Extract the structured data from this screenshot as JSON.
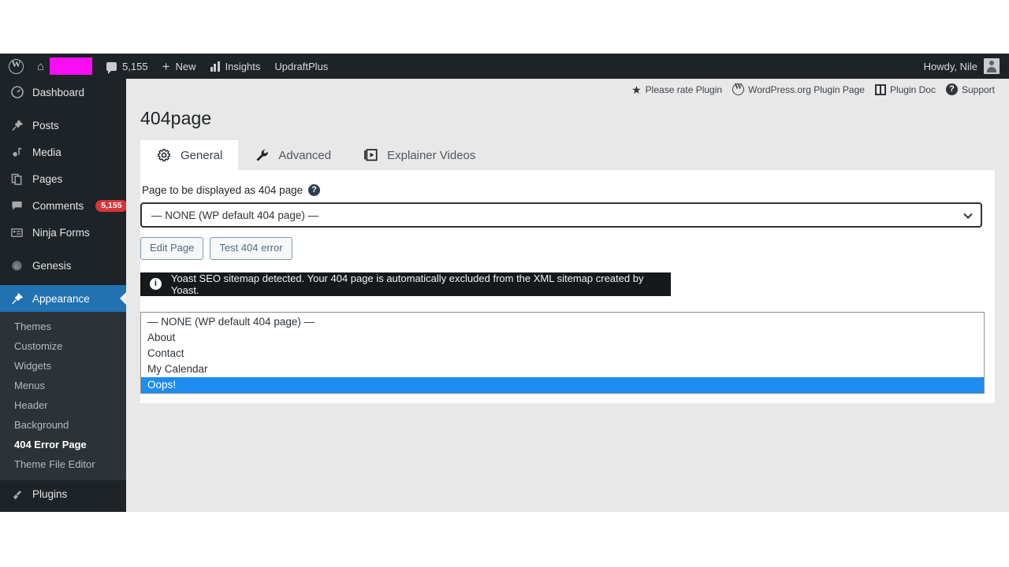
{
  "adminbar": {
    "wp_logo": "wordpress-logo-icon",
    "home_icon": "home-icon",
    "site_name_redacted": "",
    "comment_count": "5,155",
    "new_label": "New",
    "insights_label": "Insights",
    "updraftplus_label": "UpdraftPlus",
    "howdy": "Howdy, Nile"
  },
  "sidebar": {
    "items": [
      {
        "label": "Dashboard",
        "icon": "dashboard-icon",
        "badge": ""
      },
      {
        "label": "Posts",
        "icon": "pin-icon",
        "badge": ""
      },
      {
        "label": "Media",
        "icon": "media-icon",
        "badge": ""
      },
      {
        "label": "Pages",
        "icon": "pages-icon",
        "badge": ""
      },
      {
        "label": "Comments",
        "icon": "comment-icon",
        "badge": "5,155"
      },
      {
        "label": "Ninja Forms",
        "icon": "form-icon",
        "badge": ""
      },
      {
        "label": "Genesis",
        "icon": "genesis-icon",
        "badge": ""
      },
      {
        "label": "Appearance",
        "icon": "brush-icon",
        "badge": ""
      },
      {
        "label": "Plugins",
        "icon": "plug-icon",
        "badge": ""
      }
    ],
    "submenu": [
      {
        "label": "Themes"
      },
      {
        "label": "Customize"
      },
      {
        "label": "Widgets"
      },
      {
        "label": "Menus"
      },
      {
        "label": "Header"
      },
      {
        "label": "Background"
      },
      {
        "label": "404 Error Page"
      },
      {
        "label": "Theme File Editor"
      }
    ],
    "active_item": "Appearance",
    "current_subitem": "404 Error Page"
  },
  "plugin_links": [
    {
      "label": "Please rate Plugin",
      "icon": "star-icon"
    },
    {
      "label": "WordPress.org Plugin Page",
      "icon": "wordpress-logo-icon"
    },
    {
      "label": "Plugin Doc",
      "icon": "book-icon"
    },
    {
      "label": "Support",
      "icon": "question-mark-icon"
    }
  ],
  "page": {
    "title": "404page"
  },
  "tabs": [
    {
      "label": "General",
      "icon": "gear-icon",
      "active": true
    },
    {
      "label": "Advanced",
      "icon": "wrench-icon",
      "active": false
    },
    {
      "label": "Explainer Videos",
      "icon": "video-icon",
      "active": false
    }
  ],
  "form": {
    "field_label": "Page to be displayed as 404 page",
    "help_icon": "question-mark-icon",
    "select_value": "— NONE (WP default 404 page) —",
    "chevron_icon": "chevron-down-icon",
    "buttons": [
      {
        "label": "Edit Page"
      },
      {
        "label": "Test 404 error"
      }
    ]
  },
  "notice": {
    "icon": "info-icon",
    "text": "Yoast SEO sitemap detected. Your 404 page is automatically excluded from the XML sitemap created by Yoast."
  },
  "listbox": {
    "options": [
      {
        "label": "— NONE (WP default 404 page) —",
        "selected": false
      },
      {
        "label": "About",
        "selected": false
      },
      {
        "label": "Contact",
        "selected": false
      },
      {
        "label": "My Calendar",
        "selected": false
      },
      {
        "label": "Oops!",
        "selected": true
      }
    ]
  },
  "colors": {
    "admin_dark": "#1d2327",
    "accent_blue": "#2271b1",
    "highlight_blue": "#1e8cf0",
    "badge_red": "#d63638",
    "redaction_magenta": "#f90ef3"
  }
}
